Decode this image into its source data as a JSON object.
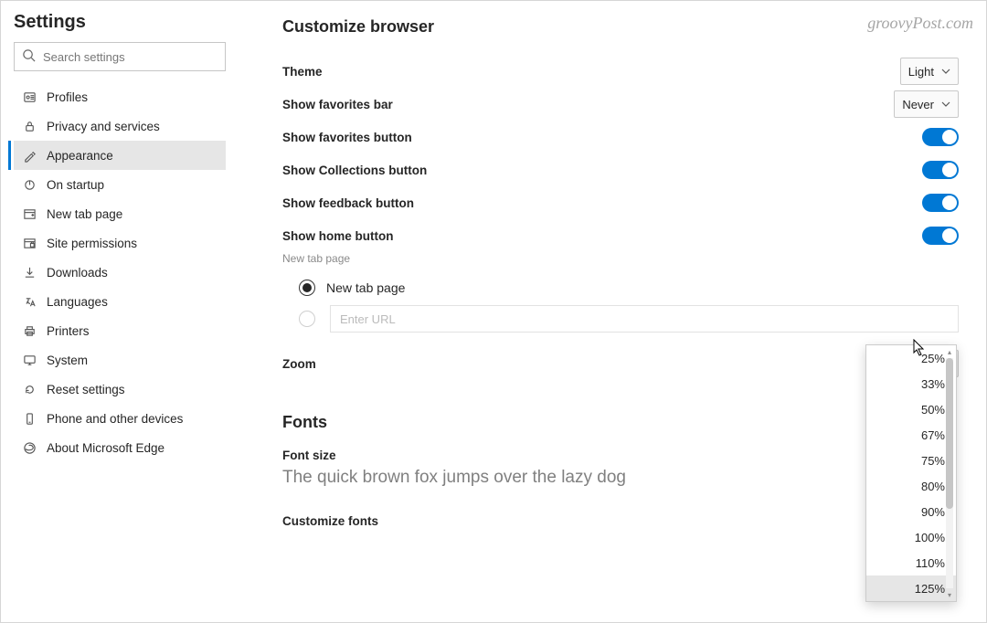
{
  "watermark": "groovyPost.com",
  "sidebar": {
    "title": "Settings",
    "search_placeholder": "Search settings",
    "items": [
      {
        "label": "Profiles",
        "icon": "profile-icon"
      },
      {
        "label": "Privacy and services",
        "icon": "lock-icon"
      },
      {
        "label": "Appearance",
        "icon": "appearance-icon",
        "active": true
      },
      {
        "label": "On startup",
        "icon": "power-icon"
      },
      {
        "label": "New tab page",
        "icon": "new-tab-icon"
      },
      {
        "label": "Site permissions",
        "icon": "permissions-icon"
      },
      {
        "label": "Downloads",
        "icon": "download-icon"
      },
      {
        "label": "Languages",
        "icon": "languages-icon"
      },
      {
        "label": "Printers",
        "icon": "printer-icon"
      },
      {
        "label": "System",
        "icon": "system-icon"
      },
      {
        "label": "Reset settings",
        "icon": "reset-icon"
      },
      {
        "label": "Phone and other devices",
        "icon": "phone-icon"
      },
      {
        "label": "About Microsoft Edge",
        "icon": "edge-icon"
      }
    ]
  },
  "main": {
    "section_title": "Customize browser",
    "theme": {
      "label": "Theme",
      "value": "Light"
    },
    "favorites_bar": {
      "label": "Show favorites bar",
      "value": "Never"
    },
    "toggles": [
      {
        "label": "Show favorites button",
        "on": true
      },
      {
        "label": "Show Collections button",
        "on": true
      },
      {
        "label": "Show feedback button",
        "on": true
      }
    ],
    "home_button": {
      "label": "Show home button",
      "sublabel": "New tab page",
      "on": true,
      "options": {
        "new_tab_label": "New tab page",
        "url_placeholder": "Enter URL"
      }
    },
    "zoom": {
      "label": "Zoom",
      "value": "125%",
      "options": [
        "25%",
        "33%",
        "50%",
        "67%",
        "75%",
        "80%",
        "90%",
        "100%",
        "110%",
        "125%"
      ],
      "selected_index": 9
    },
    "fonts": {
      "title": "Fonts",
      "font_size_label": "Font size",
      "pangram": "The quick brown fox jumps over the lazy dog",
      "customize_label": "Customize fonts"
    }
  }
}
